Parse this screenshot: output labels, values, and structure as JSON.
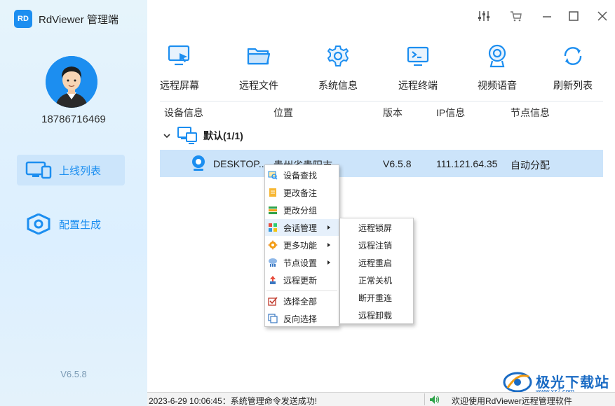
{
  "app": {
    "logo_text": "RD",
    "title": "RdViewer 管理端"
  },
  "user": {
    "phone": "18786716469"
  },
  "sidebar": {
    "items": [
      {
        "label": "上线列表",
        "icon": "monitor-devices-icon",
        "active": true
      },
      {
        "label": "配置生成",
        "icon": "hexagon-nut-icon",
        "active": false
      }
    ],
    "version": "V6.5.8"
  },
  "window_controls": [
    "settings-sliders-icon",
    "cart-icon",
    "minimize-icon",
    "maximize-icon",
    "close-icon"
  ],
  "toolbar": {
    "items": [
      {
        "label": "远程屏幕",
        "icon": "remote-screen-icon"
      },
      {
        "label": "远程文件",
        "icon": "folder-icon"
      },
      {
        "label": "系统信息",
        "icon": "gear-icon"
      },
      {
        "label": "远程终端",
        "icon": "terminal-icon"
      },
      {
        "label": "视频语音",
        "icon": "webcam-icon"
      },
      {
        "label": "刷新列表",
        "icon": "refresh-icon"
      }
    ]
  },
  "table": {
    "headers": [
      "设备信息",
      "位置",
      "版本",
      "IP信息",
      "节点信息"
    ],
    "group": {
      "label": "默认(1/1)"
    },
    "rows": [
      {
        "device": "DESKTOP...",
        "location": "贵州省贵阳市",
        "version": "V6.5.8",
        "ip": "111.121.64.35",
        "node": "自动分配"
      }
    ]
  },
  "context_menu": {
    "items": [
      {
        "label": "设备查找",
        "icon": "search-device-icon",
        "submenu": false
      },
      {
        "label": "更改备注",
        "icon": "note-icon",
        "submenu": false
      },
      {
        "label": "更改分组",
        "icon": "group-icon",
        "submenu": false
      },
      {
        "label": "会话管理",
        "icon": "session-icon",
        "submenu": true
      },
      {
        "label": "更多功能",
        "icon": "more-functions-icon",
        "submenu": true
      },
      {
        "label": "节点设置",
        "icon": "node-settings-icon",
        "submenu": true
      },
      {
        "label": "远程更新",
        "icon": "remote-update-icon",
        "submenu": false
      },
      {
        "label": "选择全部",
        "icon": "select-all-icon",
        "submenu": false
      },
      {
        "label": "反向选择",
        "icon": "invert-selection-icon",
        "submenu": false
      }
    ],
    "highlighted": "会话管理"
  },
  "submenu": {
    "items": [
      "远程锁屏",
      "远程注销",
      "远程重启",
      "正常关机",
      "断开重连",
      "远程卸载"
    ]
  },
  "statusbar": {
    "message": "2023-6-29 10:06:45：系统管理命令发送成功!",
    "welcome": "欢迎使用RdViewer远程管理软件"
  },
  "watermark": {
    "text": "极光下载站",
    "url": "www.xz7.com"
  },
  "colors": {
    "accent": "#1c8ef0",
    "row_selected": "#cce4fa",
    "sidebar_bg": "#e2f2fb"
  }
}
